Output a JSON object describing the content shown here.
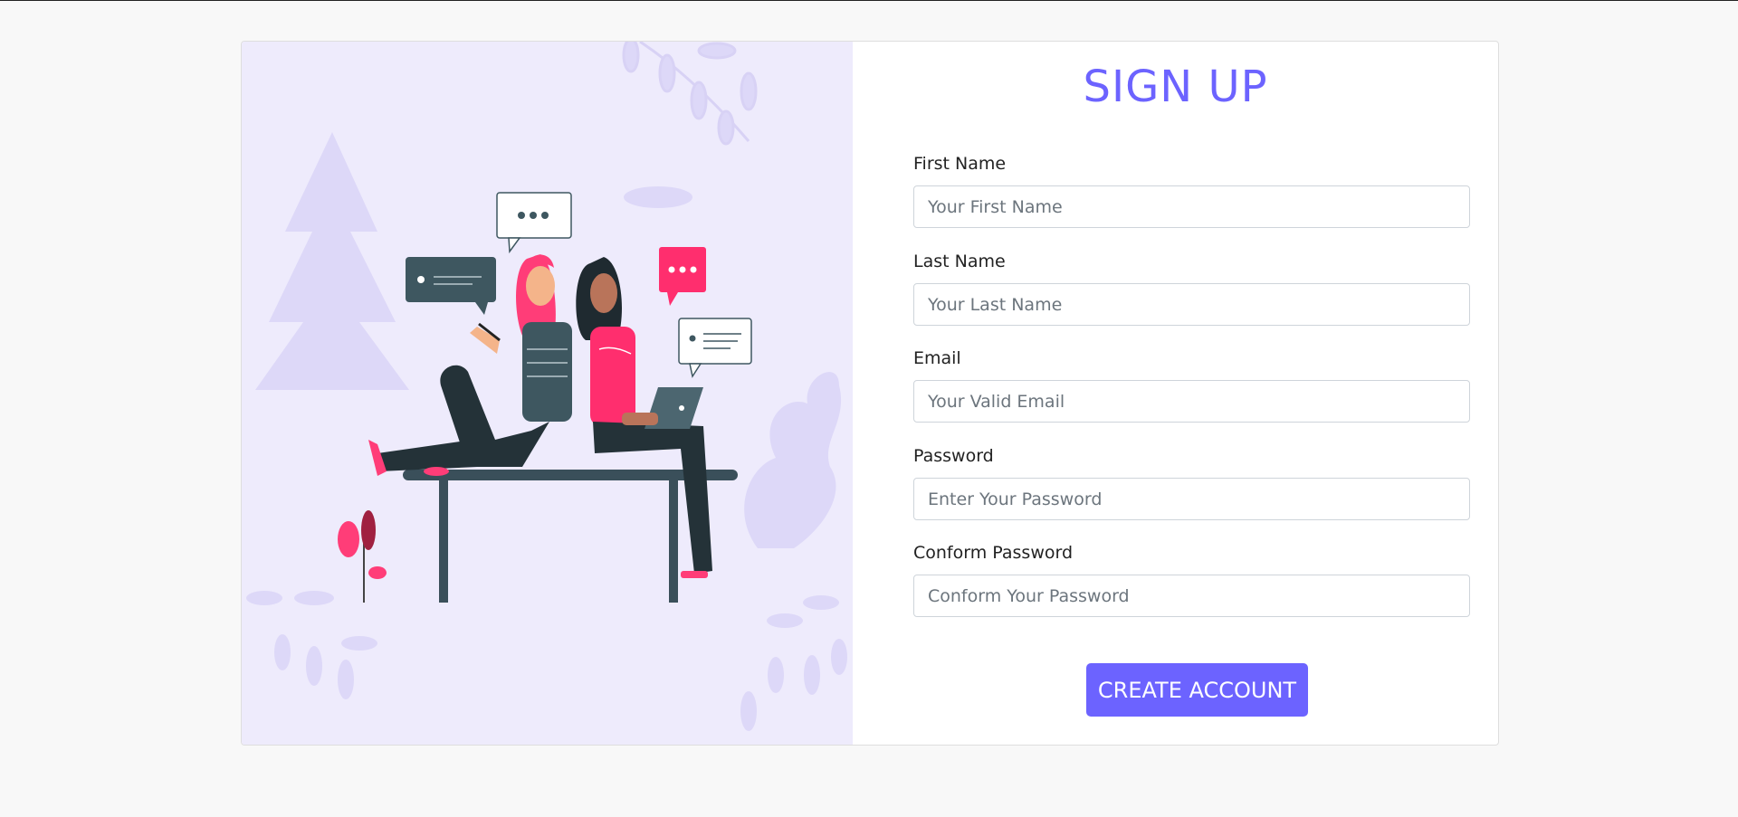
{
  "page": {
    "title": "SIGN UP",
    "accent_color": "#6c63ff",
    "illustration_bg": "#eeebfc"
  },
  "illustration": {
    "description_icon": "two-people-chatting-illustration"
  },
  "form": {
    "fields": [
      {
        "label": "First Name",
        "placeholder": "Your First Name",
        "value": ""
      },
      {
        "label": "Last Name",
        "placeholder": "Your Last Name",
        "value": ""
      },
      {
        "label": "Email",
        "placeholder": "Your Valid Email",
        "value": ""
      },
      {
        "label": "Password",
        "placeholder": "Enter Your Password",
        "value": ""
      },
      {
        "label": "Conform Password",
        "placeholder": "Conform Your Password",
        "value": ""
      }
    ],
    "submit_label": "CREATE ACCOUNT"
  }
}
